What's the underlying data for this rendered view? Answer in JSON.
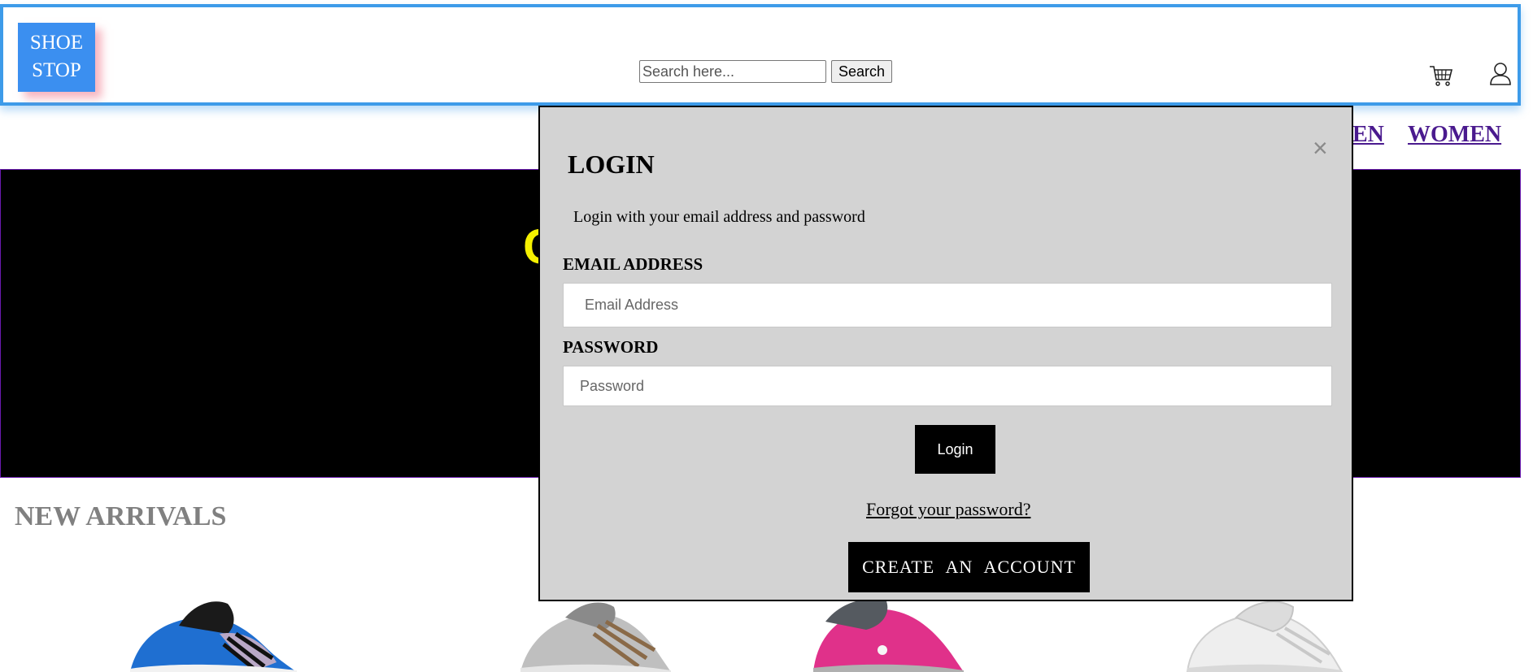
{
  "header": {
    "logo_line1": "SHOE",
    "logo_line2": "STOP",
    "search_placeholder": "Search here...",
    "search_button": "Search",
    "cart_icon": "cart-icon",
    "user_icon": "user-icon"
  },
  "nav": {
    "men_partial": "EN",
    "women": "WOMEN"
  },
  "hero": {
    "visible_letter": "C"
  },
  "sections": {
    "new_arrivals": "NEW ARRIVALS"
  },
  "modal": {
    "close": "×",
    "title": "LOGIN",
    "subtitle": "Login with your email address and password",
    "email_label": "EMAIL ADDRESS",
    "email_placeholder": "Email Address",
    "password_label": "PASSWORD",
    "password_placeholder": "Password",
    "login_button": "Login",
    "forgot_link": "Forgot your password?",
    "create_account_button": "CREATE AN ACCOUNT"
  },
  "colors": {
    "header_border": "#3d9be9",
    "logo_bg": "#3b8ff0",
    "nav_link": "#4a1a8e",
    "hero_bg": "#000000",
    "hero_text": "#f5f000",
    "modal_bg": "#d3d3d3"
  }
}
